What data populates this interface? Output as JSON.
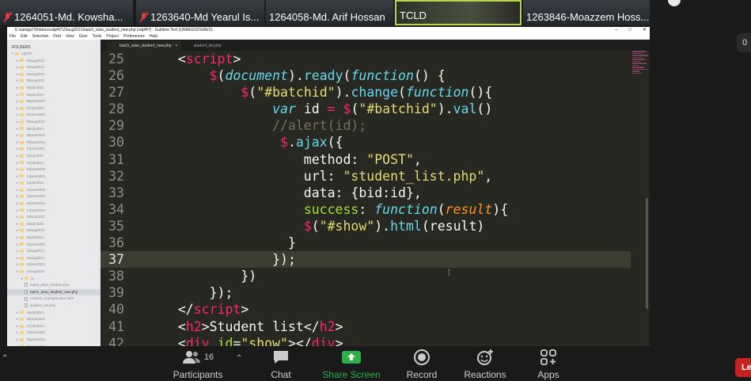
{
  "participants": [
    {
      "name": "1264051-Md. Kowsha...",
      "muted": true
    },
    {
      "name": "1263640-Md Yearul Is...",
      "muted": true
    },
    {
      "name": "1264058-Md. Arif Hossan",
      "muted": false
    },
    {
      "name": "TCLD",
      "muted": false
    },
    {
      "name": "1263846-Moazzem Hoss...",
      "muted": false
    }
  ],
  "sublime": {
    "title": "E:\\xampp73\\htdocs\\vdpf47\\23aug2021\\batch_wise_student_new.php (vdpf47) - Sublime Text (UNREGISTERED)",
    "controls": [
      "–",
      "□",
      "✕"
    ],
    "menu": [
      "File",
      "Edit",
      "Selection",
      "Find",
      "View",
      "Goto",
      "Tools",
      "Project",
      "Preferences",
      "Help"
    ],
    "sidebar_header": "FOLDERS",
    "folder_root": "vdpf47",
    "folders": [
      "02aug2021",
      "03aug2021",
      "04aug2021",
      "05aug2021",
      "05july2021",
      "06july2021",
      "06june2021",
      "07july2021",
      "07june2021",
      "08aug2021",
      "08july2021",
      "08june2021",
      "09june2021",
      "10june2021",
      "11july2021",
      "12july2021",
      "12june2021",
      "13june2021",
      "14july2021",
      "14june2021",
      "15june2021",
      "16june2021",
      "17june2021",
      "18aug2021",
      "18july2021",
      "19aug2021",
      "19july2021",
      "19june2021",
      "23aug2021",
      "24aug2021",
      "24june2021",
      "23aug2021"
    ],
    "subfolder": "js",
    "files": [
      "batch_wise_student.php",
      "batch_wise_student_new.php",
      "content_manupulation.html",
      "student_list.php"
    ],
    "folders_after": [
      "25july2021",
      "26june2021",
      "27july2021",
      "27june2021",
      "28june2021",
      "30june2021"
    ],
    "tabs": [
      "batch_wise_student_new.php",
      "student_list.php"
    ],
    "line_numbers": [
      "25",
      "26",
      "27",
      "28",
      "29",
      "30",
      "31",
      "32",
      "33",
      "34",
      "35",
      "36",
      "37",
      "38",
      "39",
      "40",
      "41",
      "42"
    ]
  },
  "side_button": "0",
  "toolbar": {
    "participants_label": "Participants",
    "participants_count": "16",
    "chat_label": "Chat",
    "share_label": "Share Screen",
    "record_label": "Record",
    "reactions_label": "Reactions",
    "apps_label": "Apps",
    "leave_label": "Le"
  },
  "colors": {
    "accent_green": "#2bb04a",
    "leave_red": "#c5221f",
    "keyword_pink": "#f92672",
    "string_yellow": "#e6db74"
  }
}
